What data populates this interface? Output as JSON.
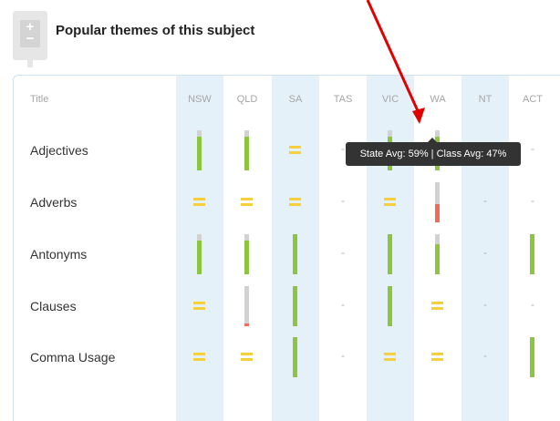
{
  "header": {
    "title": "Popular themes of this subject",
    "badge_icon": "plus-minus-icon"
  },
  "table": {
    "title_header": "Title",
    "columns": [
      "NSW",
      "QLD",
      "SA",
      "TAS",
      "VIC",
      "WA",
      "NT",
      "ACT"
    ],
    "rows": [
      {
        "label": "Adjectives",
        "cells": [
          {
            "type": "bar",
            "fill": 0.85,
            "color": "#8cc63f"
          },
          {
            "type": "bar",
            "fill": 0.85,
            "color": "#8cc63f"
          },
          {
            "type": "eq"
          },
          {
            "type": "dash"
          },
          {
            "type": "bar",
            "fill": 0.85,
            "color": "#8cc63f"
          },
          {
            "type": "bar",
            "fill": 0.85,
            "color": "#8cc63f"
          },
          {
            "type": "dash"
          },
          {
            "type": "dash"
          }
        ]
      },
      {
        "label": "Adverbs",
        "cells": [
          {
            "type": "eq"
          },
          {
            "type": "eq"
          },
          {
            "type": "eq"
          },
          {
            "type": "dash"
          },
          {
            "type": "eq"
          },
          {
            "type": "bar",
            "fill": 0.45,
            "color": "#f26a5a"
          },
          {
            "type": "dash"
          },
          {
            "type": "dash"
          }
        ]
      },
      {
        "label": "Antonyms",
        "cells": [
          {
            "type": "bar",
            "fill": 0.85,
            "color": "#8cc63f"
          },
          {
            "type": "bar",
            "fill": 0.85,
            "color": "#8cc63f"
          },
          {
            "type": "bar",
            "fill": 1,
            "color": "#8cc63f"
          },
          {
            "type": "dash"
          },
          {
            "type": "bar",
            "fill": 1,
            "color": "#8cc63f"
          },
          {
            "type": "bar",
            "fill": 0.75,
            "color": "#8cc63f"
          },
          {
            "type": "dash"
          },
          {
            "type": "bar",
            "fill": 1,
            "color": "#8cc63f"
          }
        ]
      },
      {
        "label": "Clauses",
        "cells": [
          {
            "type": "eq"
          },
          {
            "type": "bar",
            "fill": 0.06,
            "color": "#f26a5a"
          },
          {
            "type": "bar",
            "fill": 1,
            "color": "#8cc63f"
          },
          {
            "type": "dash"
          },
          {
            "type": "bar",
            "fill": 1,
            "color": "#8cc63f"
          },
          {
            "type": "eq"
          },
          {
            "type": "dash"
          },
          {
            "type": "dash"
          }
        ]
      },
      {
        "label": "Comma Usage",
        "cells": [
          {
            "type": "eq"
          },
          {
            "type": "eq"
          },
          {
            "type": "bar",
            "fill": 1,
            "color": "#8cc63f"
          },
          {
            "type": "dash"
          },
          {
            "type": "eq"
          },
          {
            "type": "eq"
          },
          {
            "type": "dash"
          },
          {
            "type": "bar",
            "fill": 1,
            "color": "#8cc63f"
          }
        ]
      }
    ]
  },
  "tooltip": {
    "text": "State Avg: 59% | Class Avg: 47%"
  },
  "colors": {
    "band": "#e5f1f9",
    "green": "#8cc63f",
    "red": "#f26a5a",
    "yellow": "#f6cf3a",
    "annotation": "#e00000"
  }
}
